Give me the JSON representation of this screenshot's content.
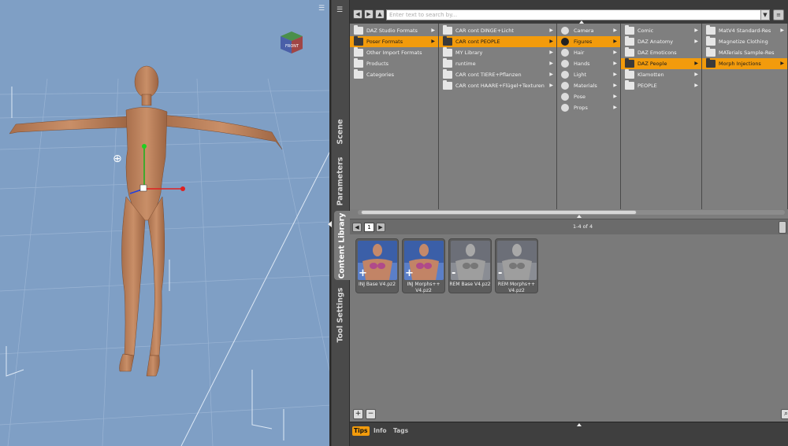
{
  "viewport": {
    "menu_icon": "menu-icon",
    "cube_label": "FRONT"
  },
  "side_tabs": [
    {
      "label": "Scene",
      "active": false
    },
    {
      "label": "Parameters",
      "active": false
    },
    {
      "label": "Content Library",
      "active": true
    },
    {
      "label": "Tool Settings",
      "active": false
    }
  ],
  "search": {
    "placeholder": "Enter text to search by...",
    "value": ""
  },
  "columns": [
    {
      "items": [
        {
          "label": "DAZ Studio Formats",
          "icon": "folder-icon",
          "selected": false,
          "arrow": true
        },
        {
          "label": "Poser Formats",
          "icon": "folder-icon",
          "selected": true,
          "arrow": true
        },
        {
          "label": "Other Import Formats",
          "icon": "folder-icon",
          "selected": false,
          "arrow": false
        },
        {
          "label": "Products",
          "icon": "folder-icon",
          "selected": false,
          "arrow": false
        },
        {
          "label": "Categories",
          "icon": "folder-icon",
          "selected": false,
          "arrow": false
        }
      ]
    },
    {
      "items": [
        {
          "label": "CAR cont DINGE+Licht",
          "icon": "folder-icon",
          "selected": false,
          "arrow": true
        },
        {
          "label": "CAR cont PEOPLE",
          "icon": "folder-icon",
          "selected": true,
          "arrow": true
        },
        {
          "label": "MY Library",
          "icon": "folder-icon",
          "selected": false,
          "arrow": true
        },
        {
          "label": "runtime",
          "icon": "folder-icon",
          "selected": false,
          "arrow": true
        },
        {
          "label": "CAR cont TIERE+Pflanzen",
          "icon": "folder-icon",
          "selected": false,
          "arrow": true
        },
        {
          "label": "CAR cont HAARE+Flügel+Texturen",
          "icon": "folder-icon",
          "selected": false,
          "arrow": true
        }
      ]
    },
    {
      "items": [
        {
          "label": "Camera",
          "icon": "camera-icon",
          "selected": false,
          "arrow": true
        },
        {
          "label": "Figures",
          "icon": "figure-icon",
          "selected": true,
          "arrow": true
        },
        {
          "label": "Hair",
          "icon": "hair-icon",
          "selected": false,
          "arrow": true
        },
        {
          "label": "Hands",
          "icon": "hand-icon",
          "selected": false,
          "arrow": true
        },
        {
          "label": "Light",
          "icon": "light-icon",
          "selected": false,
          "arrow": true
        },
        {
          "label": "Materials",
          "icon": "material-icon",
          "selected": false,
          "arrow": true
        },
        {
          "label": "Pose",
          "icon": "pose-icon",
          "selected": false,
          "arrow": true
        },
        {
          "label": "Props",
          "icon": "props-icon",
          "selected": false,
          "arrow": true
        }
      ]
    },
    {
      "items": [
        {
          "label": "Comic",
          "icon": "folder-icon",
          "selected": false,
          "arrow": true
        },
        {
          "label": "DAZ Anatomy",
          "icon": "folder-icon",
          "selected": false,
          "arrow": true
        },
        {
          "label": "DAZ Emoticons",
          "icon": "folder-icon",
          "selected": false,
          "arrow": false
        },
        {
          "label": "DAZ People",
          "icon": "folder-icon",
          "selected": true,
          "arrow": true
        },
        {
          "label": "Klamotten",
          "icon": "folder-icon",
          "selected": false,
          "arrow": true
        },
        {
          "label": "PEOPLE",
          "icon": "folder-icon",
          "selected": false,
          "arrow": true
        }
      ]
    },
    {
      "items": [
        {
          "label": "MatV4 Standard-Res",
          "icon": "folder-icon",
          "selected": false,
          "arrow": true
        },
        {
          "label": "Magnetize Clothing",
          "icon": "folder-icon",
          "selected": false,
          "arrow": false
        },
        {
          "label": "MATerials Sample-Res",
          "icon": "folder-icon",
          "selected": false,
          "arrow": false
        },
        {
          "label": "Morph Injections",
          "icon": "folder-icon",
          "selected": true,
          "arrow": true
        }
      ]
    }
  ],
  "pager": {
    "page": "1",
    "count": "1-4 of 4"
  },
  "tiles": [
    {
      "label": "INJ Base V4.pz2",
      "sign": "+",
      "tone": "color"
    },
    {
      "label": "INJ Morphs++ V4.pz2",
      "sign": "+",
      "tone": "color"
    },
    {
      "label": "REM Base V4.pz2",
      "sign": "-",
      "tone": "gray"
    },
    {
      "label": "REM Morphs++ V4.pz2",
      "sign": "-",
      "tone": "gray"
    }
  ],
  "bottom_tabs": [
    {
      "label": "Tips",
      "active": true
    },
    {
      "label": "Info",
      "active": false
    },
    {
      "label": "Tags",
      "active": false
    }
  ],
  "colors": {
    "accent": "#f29b0c",
    "viewport_bg": "#7f9fc5",
    "panel_bg": "#7d7d7d"
  }
}
